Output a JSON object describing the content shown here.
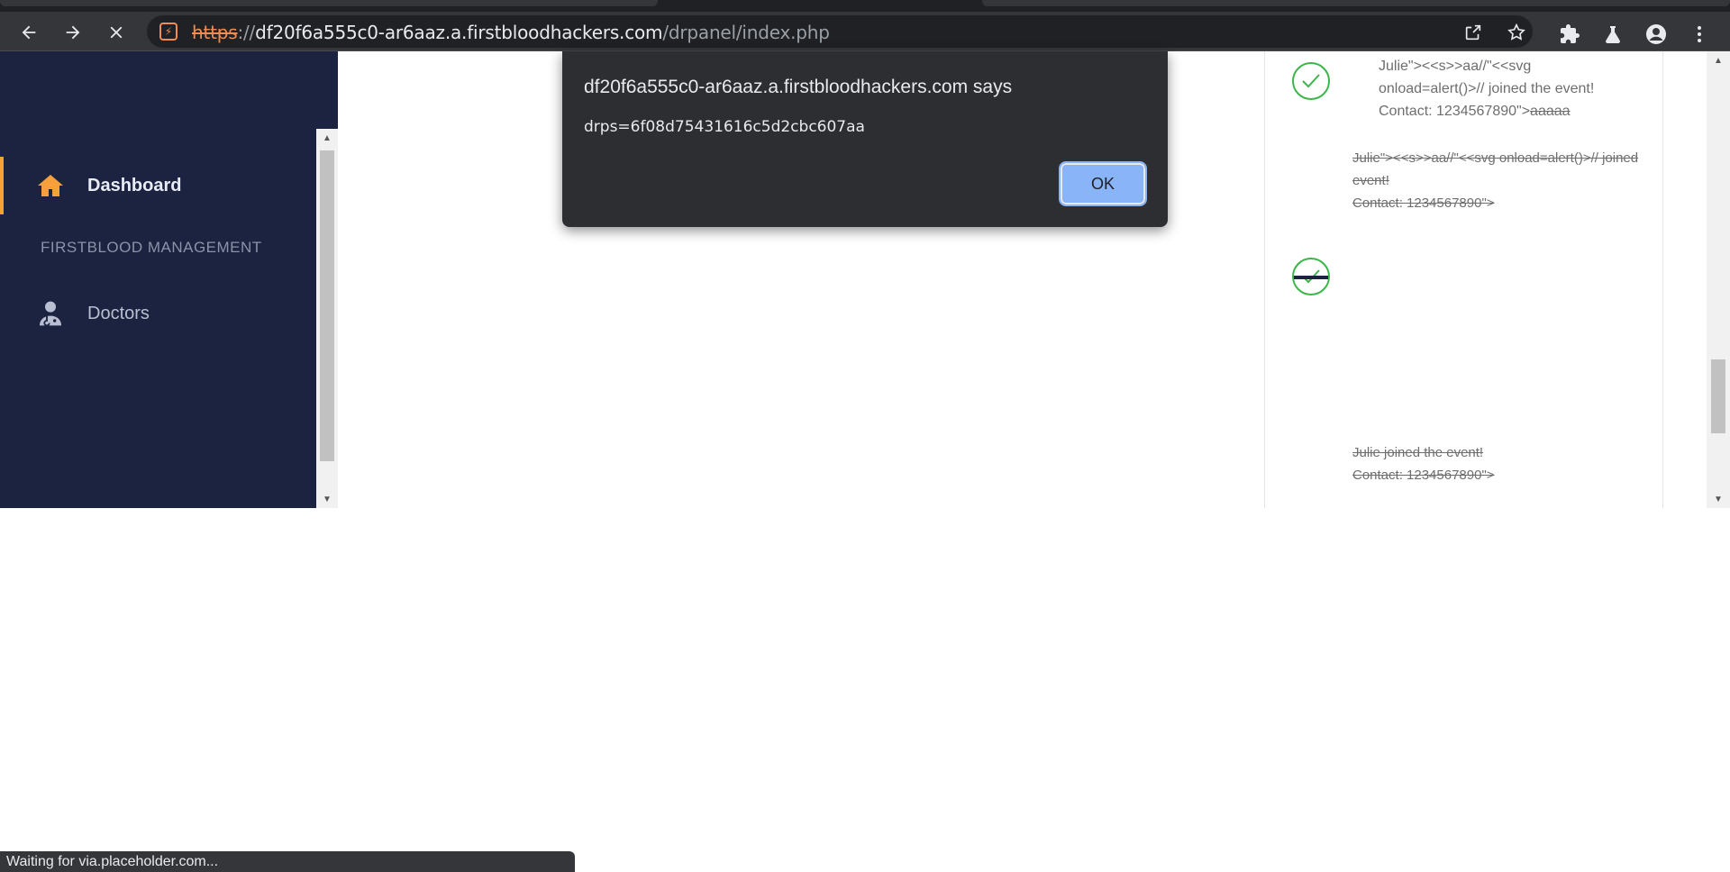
{
  "browser": {
    "url_scheme": "https",
    "url_sep": "://",
    "url_host": "df20f6a555c0-ar6aaz.a.firstbloodhackers.com",
    "url_path": "/drpanel/index.php",
    "status_text": "Waiting for via.placeholder.com..."
  },
  "dialog": {
    "title": "df20f6a555c0-ar6aaz.a.firstbloodhackers.com says",
    "message": "drps=6f08d75431616c5d2cbc607aa",
    "ok_label": "OK"
  },
  "sidebar": {
    "items": [
      {
        "label": "Dashboard",
        "icon": "home-icon",
        "active": true
      },
      {
        "label": "Doctors",
        "icon": "doctor-icon",
        "active": false
      }
    ],
    "section_label": "FIRSTBLOOD MANAGEMENT"
  },
  "feed": {
    "item1_line1": "Julie\"><<s>>aa//\"<<svg",
    "item1_line2": "onload=alert()>// joined the event!",
    "item1_line3_prefix": "Contact: 1234567890\">",
    "item1_line3_strike": "aaaaa",
    "item2_line1": "Julie\"><<s>>aa//\"<<svg onload=alert()>// joined",
    "item2_line2": "event!",
    "item2_line3": "Contact: 1234567890\">",
    "item3_line1": "Julie joined the event!",
    "item3_line2": "Contact: 1234567890\">"
  },
  "colors": {
    "sidebar_bg": "#1b2340",
    "accent": "#f6a03b",
    "check_green": "#3cb54a",
    "dialog_bg": "#2d2e31",
    "ok_button": "#8ab4f8"
  }
}
